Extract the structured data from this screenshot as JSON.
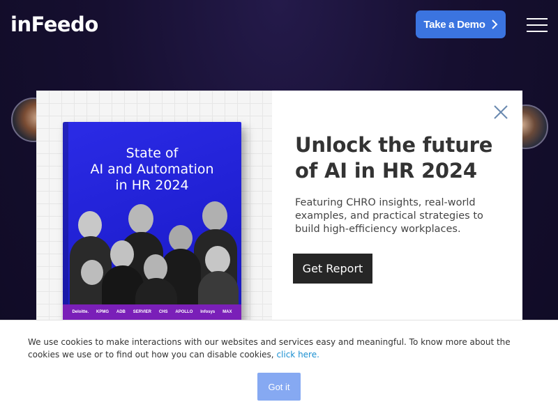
{
  "header": {
    "logo_text": "inFeedo",
    "demo_button_label": "Take a Demo",
    "menu_icon": "hamburger-icon",
    "accent_color": "#3b74e0"
  },
  "modal": {
    "book": {
      "title_lines": [
        "State of",
        "AI and Automation",
        "in HR 2024"
      ],
      "partner_logos": [
        "Deloitte.",
        "KPMG",
        "ADB",
        "SERVIER",
        "CHS",
        "APOLLO",
        "Infosys",
        "MAX"
      ]
    },
    "headline_lines": [
      "Unlock the future",
      "of AI in HR 2024"
    ],
    "description_lines": [
      "Featuring CHRO insights, real-world",
      "examples, and practical strategies to",
      "build high-efficiency workplaces."
    ],
    "cta_label": "Get Report",
    "close_icon": "close-icon"
  },
  "cookie_banner": {
    "text": "We use cookies to make interactions with our websites and services easy and meaningful. To know more about the cookies we use or to find out how you can disable cookies, ",
    "link_text": "click here.",
    "button_label": "Got it",
    "button_color": "#86a9f2"
  }
}
